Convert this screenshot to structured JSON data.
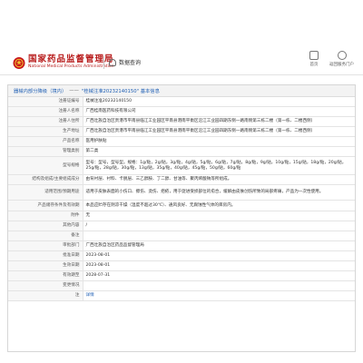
{
  "header": {
    "title_cn": "国家药品监督管理局",
    "title_en": "National Medical Products Administration",
    "db_query_label": "数据查询",
    "nav": [
      {
        "label": "首页",
        "icon": "home-icon"
      },
      {
        "label": "返回服务门户",
        "icon": "portal-icon"
      }
    ]
  },
  "breadcrumb": {
    "root": "器械内部分降级（境内）",
    "separator": "——",
    "current": "\"桂械注准20232140150\" 基本信息"
  },
  "rows": [
    {
      "label": "注册证编号",
      "value": "桂械注准20232140150"
    },
    {
      "label": "注册人名称",
      "value": "广西桂南医药科技有限公司"
    },
    {
      "label": "注册人住所",
      "value": "广西壮族自治区贵港市平南县临江工业园区平南县港南平衡区沿江工业园四期东侧一路南侧第三栋二楼（第一栋、二楼西侧）"
    },
    {
      "label": "生产地址",
      "value": "广西壮族自治区贵港市平南县临江工业园区平南县港南平衡区沿江工业园四期东侧一路南侧第三栋二楼（第一栋、二楼西侧）"
    },
    {
      "label": "产品名称",
      "value": "医用护肤贴"
    },
    {
      "label": "管理类别",
      "value": "第二类"
    },
    {
      "label": "型号规格",
      "value": "型号：型号，型号型。规格：1g/贴，2g/贴，3g/贴，4g/贴，5g/贴，6g/贴，7g/贴，8g/贴，9g/贴，10g/贴，15g/贴，18g/贴，20g/贴，25g/贴，28g/贴，30g/贴，13g/贴，35g/贴，40g/贴，45g/贴，50g/贴，60g/贴"
    },
    {
      "label": "结构及组成/主要组成成分",
      "value": "由背衬层、衬料、卡脱层、三乙醇胺、丁二醇、甘油等、聚丙烯酸钠等所组成。"
    },
    {
      "label": "适用范围/预期用途",
      "value": "适用于皮肤表面的小伤口、擦伤、烫伤、疤疮，用于促进受损部位的愈合，缓解由皮肤创伤所致的局部疼痛，产品为一次性使用。"
    },
    {
      "label": "产品储存条件及有效期",
      "value": "本品应贮存在阴凉干燥（温度不超过30℃）、通风良好、无腐蚀性气体的库房内。"
    },
    {
      "label": "附件",
      "value": "无"
    },
    {
      "label": "其他内容",
      "value": "/"
    },
    {
      "label": "备注",
      "value": ""
    },
    {
      "label": "审批部门",
      "value": "广西壮族自治区药品监督管理局"
    },
    {
      "label": "批准日期",
      "value": "2023-08-01"
    },
    {
      "label": "生效日期",
      "value": "2023-08-01"
    },
    {
      "label": "有效期至",
      "value": "2028-07-31"
    },
    {
      "label": "变更情况",
      "value": ""
    },
    {
      "label": "注",
      "value": "详情"
    }
  ]
}
